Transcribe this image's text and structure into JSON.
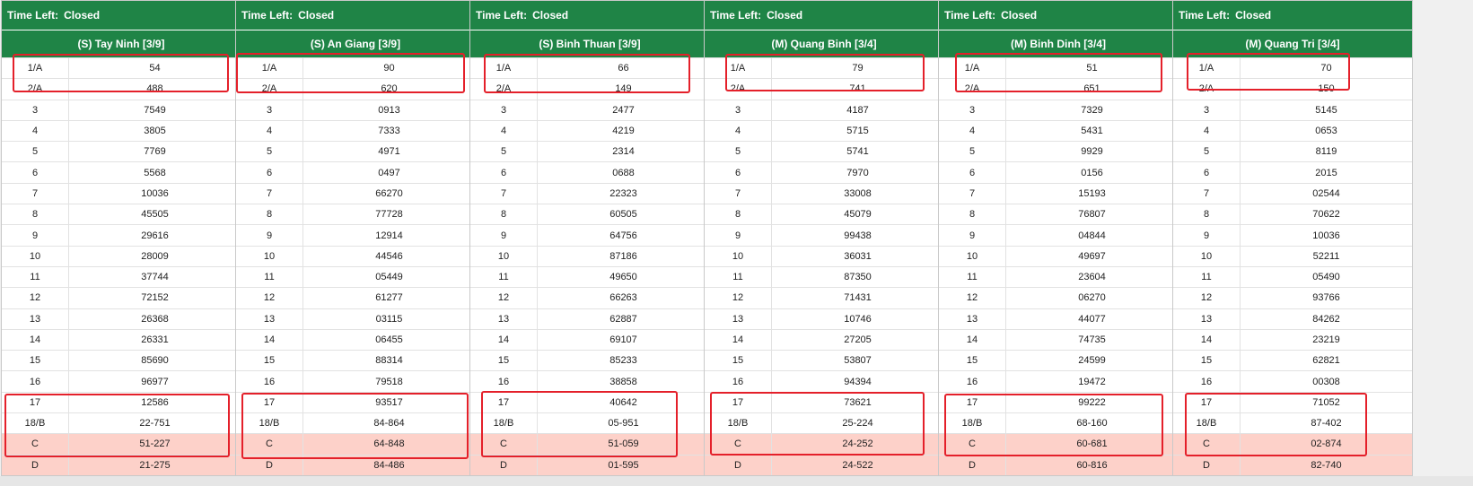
{
  "time_left_label": "Time Left:",
  "panels": [
    {
      "time_status": "Closed",
      "title": "(S) Tay Ninh [3/9]",
      "rows": [
        {
          "prize": "1/A",
          "value": "54"
        },
        {
          "prize": "2/A",
          "value": "488"
        },
        {
          "prize": "3",
          "value": "7549"
        },
        {
          "prize": "4",
          "value": "3805"
        },
        {
          "prize": "5",
          "value": "7769"
        },
        {
          "prize": "6",
          "value": "5568"
        },
        {
          "prize": "7",
          "value": "10036"
        },
        {
          "prize": "8",
          "value": "45505"
        },
        {
          "prize": "9",
          "value": "29616"
        },
        {
          "prize": "10",
          "value": "28009"
        },
        {
          "prize": "11",
          "value": "37744"
        },
        {
          "prize": "12",
          "value": "72152"
        },
        {
          "prize": "13",
          "value": "26368"
        },
        {
          "prize": "14",
          "value": "26331"
        },
        {
          "prize": "15",
          "value": "85690"
        },
        {
          "prize": "16",
          "value": "96977"
        },
        {
          "prize": "17",
          "value": "12586"
        },
        {
          "prize": "18/B",
          "value": "22-751"
        },
        {
          "prize": "C",
          "value": "51-227"
        },
        {
          "prize": "D",
          "value": "21-275"
        }
      ]
    },
    {
      "time_status": "Closed",
      "title": "(S) An Giang [3/9]",
      "rows": [
        {
          "prize": "1/A",
          "value": "90"
        },
        {
          "prize": "2/A",
          "value": "620"
        },
        {
          "prize": "3",
          "value": "0913"
        },
        {
          "prize": "4",
          "value": "7333"
        },
        {
          "prize": "5",
          "value": "4971"
        },
        {
          "prize": "6",
          "value": "0497"
        },
        {
          "prize": "7",
          "value": "66270"
        },
        {
          "prize": "8",
          "value": "77728"
        },
        {
          "prize": "9",
          "value": "12914"
        },
        {
          "prize": "10",
          "value": "44546"
        },
        {
          "prize": "11",
          "value": "05449"
        },
        {
          "prize": "12",
          "value": "61277"
        },
        {
          "prize": "13",
          "value": "03115"
        },
        {
          "prize": "14",
          "value": "06455"
        },
        {
          "prize": "15",
          "value": "88314"
        },
        {
          "prize": "16",
          "value": "79518"
        },
        {
          "prize": "17",
          "value": "93517"
        },
        {
          "prize": "18/B",
          "value": "84-864"
        },
        {
          "prize": "C",
          "value": "64-848"
        },
        {
          "prize": "D",
          "value": "84-486"
        }
      ]
    },
    {
      "time_status": "Closed",
      "title": "(S) Binh Thuan [3/9]",
      "rows": [
        {
          "prize": "1/A",
          "value": "66"
        },
        {
          "prize": "2/A",
          "value": "149"
        },
        {
          "prize": "3",
          "value": "2477"
        },
        {
          "prize": "4",
          "value": "4219"
        },
        {
          "prize": "5",
          "value": "2314"
        },
        {
          "prize": "6",
          "value": "0688"
        },
        {
          "prize": "7",
          "value": "22323"
        },
        {
          "prize": "8",
          "value": "60505"
        },
        {
          "prize": "9",
          "value": "64756"
        },
        {
          "prize": "10",
          "value": "87186"
        },
        {
          "prize": "11",
          "value": "49650"
        },
        {
          "prize": "12",
          "value": "66263"
        },
        {
          "prize": "13",
          "value": "62887"
        },
        {
          "prize": "14",
          "value": "69107"
        },
        {
          "prize": "15",
          "value": "85233"
        },
        {
          "prize": "16",
          "value": "38858"
        },
        {
          "prize": "17",
          "value": "40642"
        },
        {
          "prize": "18/B",
          "value": "05-951"
        },
        {
          "prize": "C",
          "value": "51-059"
        },
        {
          "prize": "D",
          "value": "01-595"
        }
      ]
    },
    {
      "time_status": "Closed",
      "title": "(M) Quang Binh [3/4]",
      "rows": [
        {
          "prize": "1/A",
          "value": "79"
        },
        {
          "prize": "2/A",
          "value": "741"
        },
        {
          "prize": "3",
          "value": "4187"
        },
        {
          "prize": "4",
          "value": "5715"
        },
        {
          "prize": "5",
          "value": "5741"
        },
        {
          "prize": "6",
          "value": "7970"
        },
        {
          "prize": "7",
          "value": "33008"
        },
        {
          "prize": "8",
          "value": "45079"
        },
        {
          "prize": "9",
          "value": "99438"
        },
        {
          "prize": "10",
          "value": "36031"
        },
        {
          "prize": "11",
          "value": "87350"
        },
        {
          "prize": "12",
          "value": "71431"
        },
        {
          "prize": "13",
          "value": "10746"
        },
        {
          "prize": "14",
          "value": "27205"
        },
        {
          "prize": "15",
          "value": "53807"
        },
        {
          "prize": "16",
          "value": "94394"
        },
        {
          "prize": "17",
          "value": "73621"
        },
        {
          "prize": "18/B",
          "value": "25-224"
        },
        {
          "prize": "C",
          "value": "24-252"
        },
        {
          "prize": "D",
          "value": "24-522"
        }
      ]
    },
    {
      "time_status": "Closed",
      "title": "(M) Binh Dinh [3/4]",
      "rows": [
        {
          "prize": "1/A",
          "value": "51"
        },
        {
          "prize": "2/A",
          "value": "651"
        },
        {
          "prize": "3",
          "value": "7329"
        },
        {
          "prize": "4",
          "value": "5431"
        },
        {
          "prize": "5",
          "value": "9929"
        },
        {
          "prize": "6",
          "value": "0156"
        },
        {
          "prize": "7",
          "value": "15193"
        },
        {
          "prize": "8",
          "value": "76807"
        },
        {
          "prize": "9",
          "value": "04844"
        },
        {
          "prize": "10",
          "value": "49697"
        },
        {
          "prize": "11",
          "value": "23604"
        },
        {
          "prize": "12",
          "value": "06270"
        },
        {
          "prize": "13",
          "value": "44077"
        },
        {
          "prize": "14",
          "value": "74735"
        },
        {
          "prize": "15",
          "value": "24599"
        },
        {
          "prize": "16",
          "value": "19472"
        },
        {
          "prize": "17",
          "value": "99222"
        },
        {
          "prize": "18/B",
          "value": "68-160"
        },
        {
          "prize": "C",
          "value": "60-681"
        },
        {
          "prize": "D",
          "value": "60-816"
        }
      ]
    },
    {
      "time_status": "Closed",
      "title": "(M) Quang Tri [3/4]",
      "rows": [
        {
          "prize": "1/A",
          "value": "70"
        },
        {
          "prize": "2/A",
          "value": "150"
        },
        {
          "prize": "3",
          "value": "5145"
        },
        {
          "prize": "4",
          "value": "0653"
        },
        {
          "prize": "5",
          "value": "8119"
        },
        {
          "prize": "6",
          "value": "2015"
        },
        {
          "prize": "7",
          "value": "02544"
        },
        {
          "prize": "8",
          "value": "70622"
        },
        {
          "prize": "9",
          "value": "10036"
        },
        {
          "prize": "10",
          "value": "52211"
        },
        {
          "prize": "11",
          "value": "05490"
        },
        {
          "prize": "12",
          "value": "93766"
        },
        {
          "prize": "13",
          "value": "84262"
        },
        {
          "prize": "14",
          "value": "23219"
        },
        {
          "prize": "15",
          "value": "62821"
        },
        {
          "prize": "16",
          "value": "00308"
        },
        {
          "prize": "17",
          "value": "71052"
        },
        {
          "prize": "18/B",
          "value": "87-402"
        },
        {
          "prize": "C",
          "value": "02-874"
        },
        {
          "prize": "D",
          "value": "82-740"
        }
      ]
    }
  ],
  "colors": {
    "header_green": "#1f8446",
    "highlight_pink": "#fdd1c9",
    "annotation_red": "#e4202a"
  }
}
